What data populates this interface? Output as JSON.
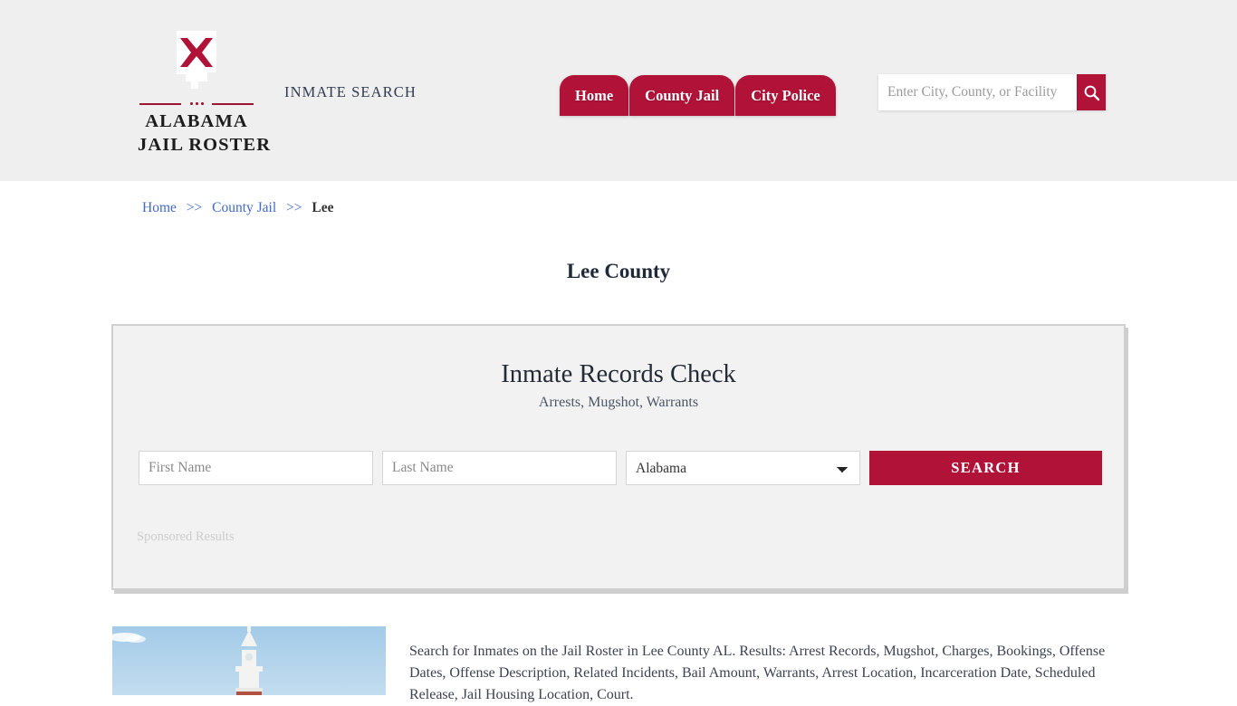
{
  "header": {
    "logo": {
      "line1": "ALABAMA",
      "line2": "JAIL ROSTER",
      "mark_name": "alabama-state-cross-logo"
    },
    "tagline": "INMATE SEARCH",
    "nav": [
      {
        "label": "Home"
      },
      {
        "label": "County Jail"
      },
      {
        "label": "City Police"
      }
    ],
    "search": {
      "placeholder": "Enter City, County, or Facility",
      "value": "",
      "button_icon": "search-icon"
    },
    "background_color": "#efefef"
  },
  "breadcrumb": {
    "items": [
      {
        "label": "Home",
        "link": true
      },
      {
        "label": "County Jail",
        "link": true
      },
      {
        "label": "Lee",
        "link": false
      }
    ],
    "separator": ">>"
  },
  "page": {
    "title": "Lee County"
  },
  "panel": {
    "title": "Inmate Records Check",
    "subtitle": "Arrests, Mugshot, Warrants",
    "form": {
      "first_name_placeholder": "First Name",
      "first_name_value": "",
      "last_name_placeholder": "Last Name",
      "last_name_value": "",
      "state_selected": "Alabama",
      "state_options": [
        "Alabama"
      ],
      "search_button": "SEARCH"
    },
    "sponsored_label": "Sponsored Results"
  },
  "content": {
    "thumbnail_alt": "Lee County courthouse clock tower",
    "description": "Search for Inmates on the Jail Roster in Lee County AL. Results: Arrest Records, Mugshot, Charges, Bookings, Offense Dates, Offense Description, Related Incidents, Bail Amount, Warrants, Arrest Location, Incarceration Date, Scheduled Release, Jail Housing Location, Court."
  },
  "colors": {
    "brand_crimson": "#b01238",
    "link_blue": "#4169c8",
    "header_gray": "#efefef",
    "panel_gray": "#f2f2f2"
  }
}
